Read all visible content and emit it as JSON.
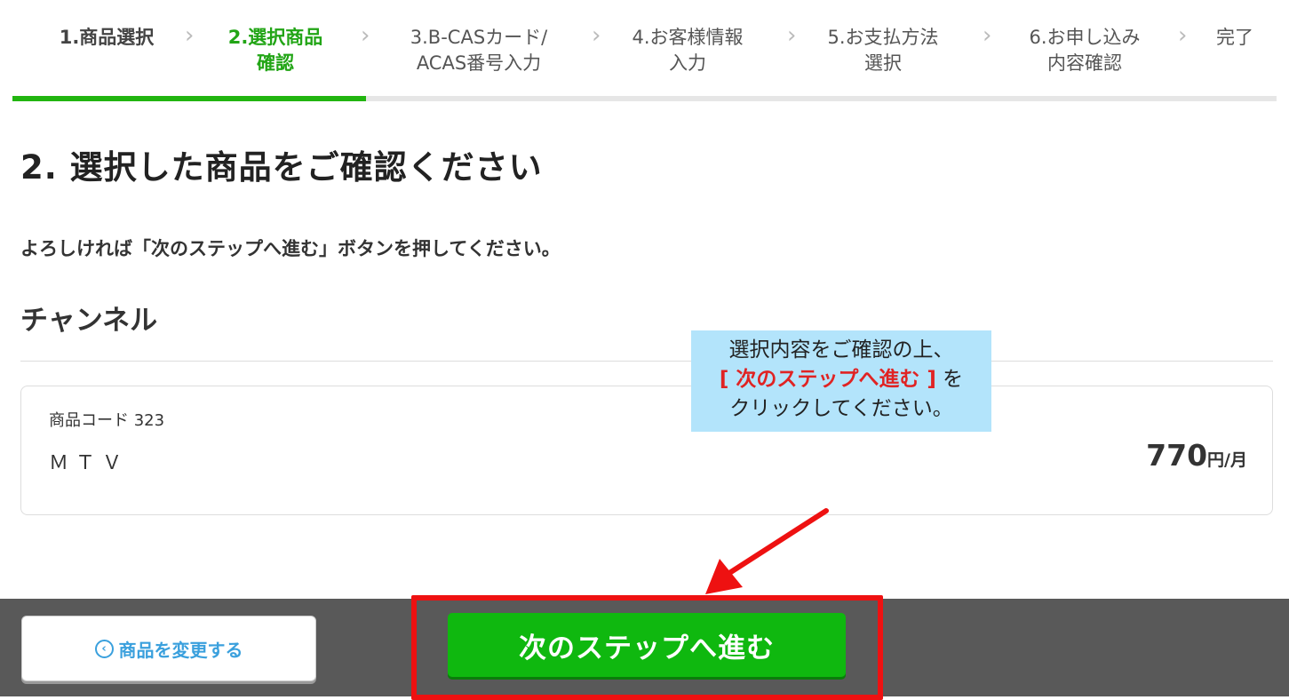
{
  "steps": {
    "items": [
      {
        "label": "1.商品選択",
        "state": "done"
      },
      {
        "label": "2.選択商品\n確認",
        "state": "current"
      },
      {
        "label": "3.B-CASカード/\nACAS番号入力",
        "state": "upcoming"
      },
      {
        "label": "4.お客様情報\n入力",
        "state": "upcoming"
      },
      {
        "label": "5.お支払方法\n選択",
        "state": "upcoming"
      },
      {
        "label": "6.お申し込み\n内容確認",
        "state": "upcoming"
      },
      {
        "label": "完了",
        "state": "upcoming"
      }
    ],
    "progress_fraction": 0.28,
    "separator_icon": "chevron-right-icon"
  },
  "main": {
    "title": "2. 選択した商品をご確認ください",
    "instruction": "よろしければ「次のステップへ進む」ボタンを押してください。",
    "section_title": "チャンネル",
    "product": {
      "code_label": "商品コード 323",
      "name": "ＭＴＶ",
      "price": "770",
      "price_unit": "円/月"
    }
  },
  "callout": {
    "line1": "選択内容をご確認の上、",
    "highlight": "[ 次のステップへ進む ]",
    "line2_suffix": " を",
    "line3": "クリックしてください。"
  },
  "footer": {
    "change_label": "商品を変更する",
    "change_icon": "circle-chevron-left-icon",
    "next_label": "次のステップへ進む"
  },
  "colors": {
    "accent_green": "#22a516",
    "button_green": "#0fb80f",
    "link_blue": "#3aa0dd",
    "annotation_red": "#ee1111",
    "callout_bg": "#b3e4fb",
    "footer_bg": "#595959"
  }
}
